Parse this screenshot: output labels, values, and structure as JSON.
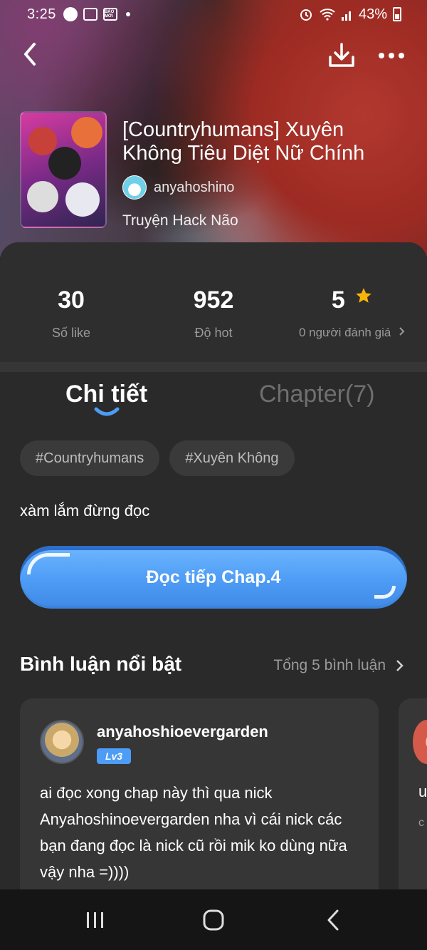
{
  "status_bar": {
    "time": "3:25",
    "news_label": "BÁO MỚI",
    "battery": "43%"
  },
  "story": {
    "title": "[Countryhumans] Xuyên Không Tiêu Diệt Nữ Chính",
    "author": "anyahoshino",
    "genre": "Truyện Hack Não"
  },
  "stats": {
    "likes_value": "30",
    "likes_label": "Số like",
    "hot_value": "952",
    "hot_label": "Độ hot",
    "rating_value": "5",
    "rating_label": "0 người đánh giá"
  },
  "tabs": {
    "detail": "Chi tiết",
    "chapter": "Chapter(7)"
  },
  "tags": [
    "#Countryhumans",
    "#Xuyên Không"
  ],
  "description": "xàm lắm đừng đọc",
  "read_button": "Đọc tiếp Chap.4",
  "comments": {
    "title": "Bình luận nổi bật",
    "count": "Tổng 5 bình luận",
    "items": [
      {
        "user": "anyahoshioevergarden",
        "level": "Lv3",
        "text": "ai đọc xong chap này thì qua nick Anyahoshinoevergarden nha vì cái nick các bạn đang đọc là nick cũ rồi mik ko dùng nữa vậy nha =))))"
      },
      {
        "text_visible": "u",
        "sub_visible": "c"
      }
    ]
  },
  "colors": {
    "accent": "#4d9cf5",
    "background": "#2a2a2a",
    "card": "#363636",
    "star": "#f5b50a"
  }
}
